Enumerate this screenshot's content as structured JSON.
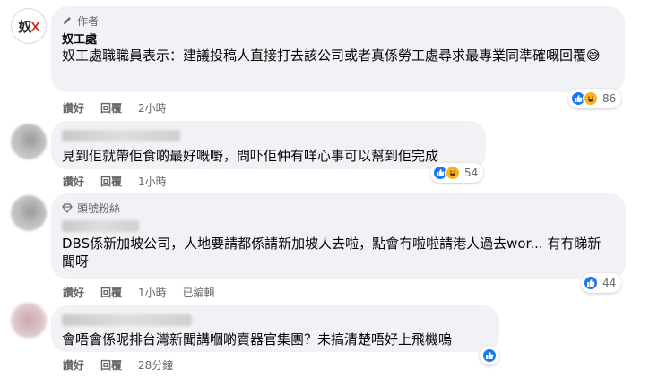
{
  "comments": [
    {
      "badge": "作者",
      "author": "奴工處",
      "text": "奴工處職職員表示：建議投稿人直接打去該公司或者真係勞工處尋求最專業同準確嘅回覆😅",
      "actions": {
        "like": "讚好",
        "reply": "回覆",
        "time": "2小時"
      },
      "reactions": {
        "count": "86",
        "icons": [
          "like-icon",
          "haha-icon"
        ]
      }
    },
    {
      "text": "見到佢就帶佢食啲最好嘅嘢，問吓佢仲有咩心事可以幫到佢完成",
      "actions": {
        "like": "讚好",
        "reply": "回覆",
        "time": "1小時"
      },
      "reactions": {
        "count": "54",
        "icons": [
          "like-icon",
          "haha-icon"
        ]
      }
    },
    {
      "badge": "頭號粉絲",
      "text": "DBS係新加坡公司，人地要請都係請新加坡人去啦，點會冇啦啦請港人過去wor... 有冇睇新聞呀",
      "actions": {
        "like": "讚好",
        "reply": "回覆",
        "time": "1小時",
        "edited": "已編輯"
      },
      "reactions": {
        "count": "44",
        "icons": [
          "like-icon"
        ]
      }
    },
    {
      "text": "會唔會係呢排台灣新聞講嗰啲賣器官集團？未搞清楚唔好上飛機嗚",
      "actions": {
        "like": "讚好",
        "reply": "回覆",
        "time": "28分鐘"
      },
      "reactions": {
        "count": "",
        "icons": [
          "like-icon"
        ]
      }
    }
  ],
  "colors": {
    "bubble": "#f0f2f5",
    "like": "#1877f2",
    "haha": "#f7b125",
    "meta": "#65676b"
  }
}
